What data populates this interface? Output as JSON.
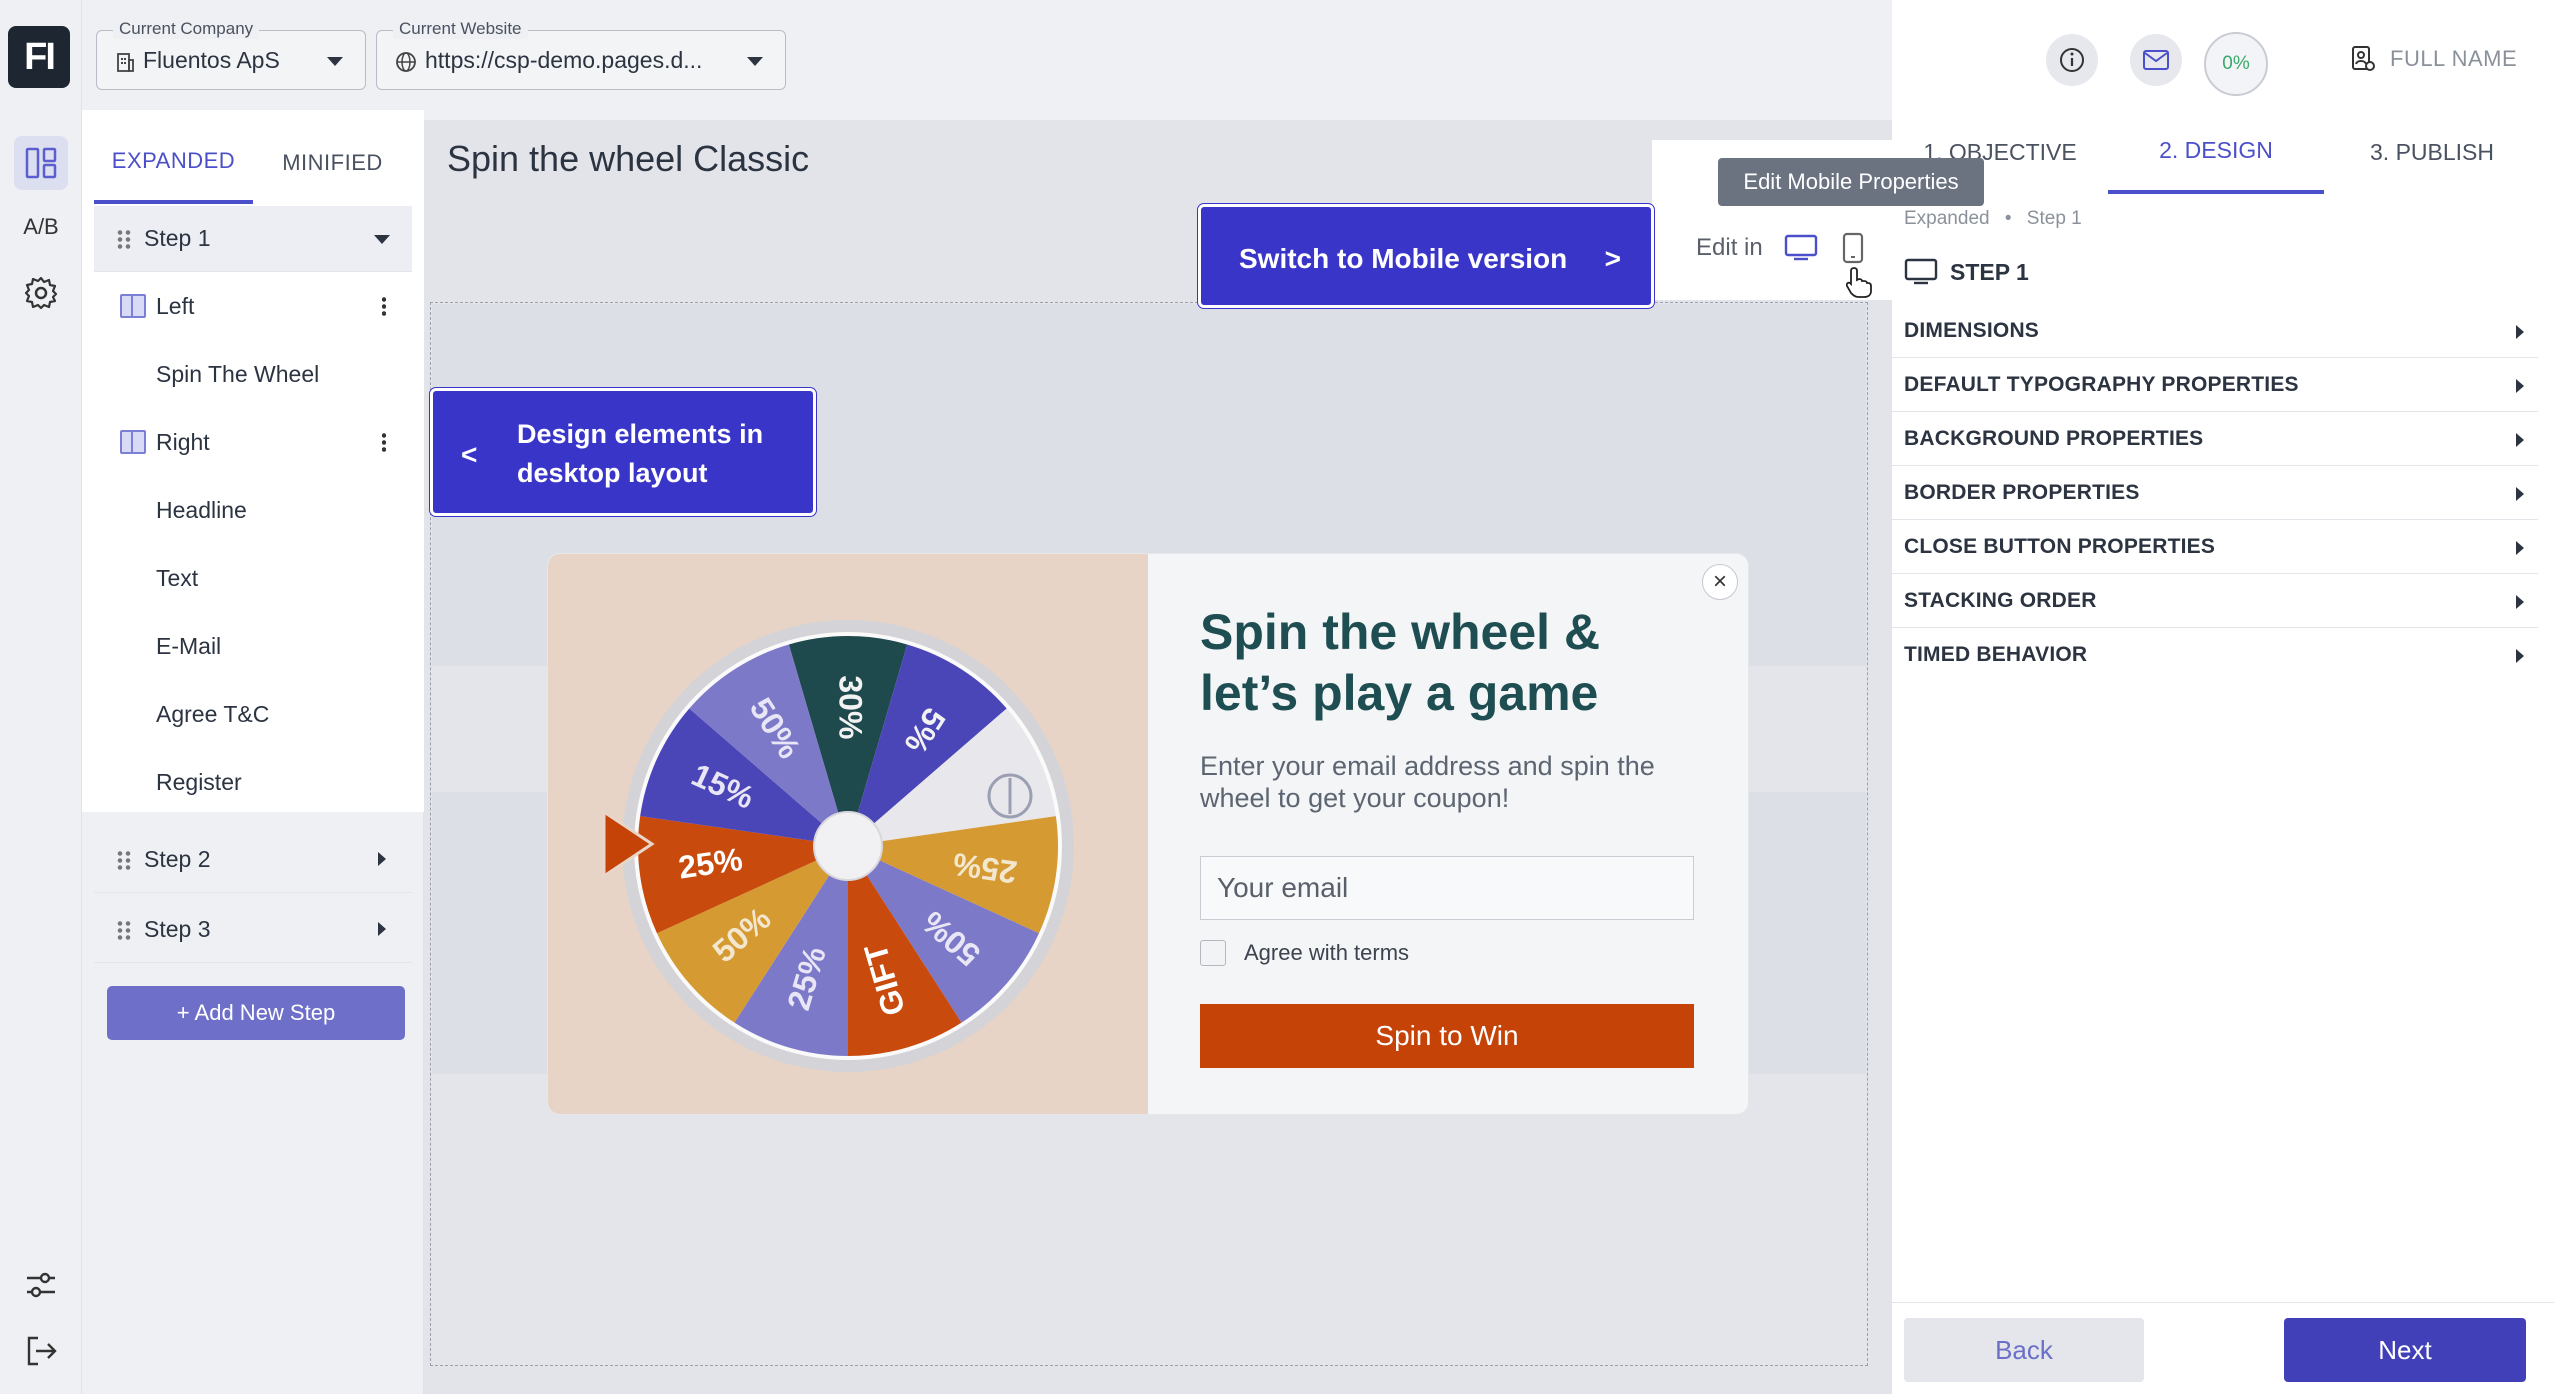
{
  "app": {
    "logo": "FI"
  },
  "rail": {
    "ab_label": "A/B"
  },
  "header": {
    "company": {
      "legend": "Current Company",
      "value": "Fluentos ApS"
    },
    "website": {
      "legend": "Current Website",
      "value": "https://csp-demo.pages.d..."
    },
    "progress": "0%",
    "user": "FULL NAME"
  },
  "left_panel": {
    "tabs": [
      "EXPANDED",
      "MINIFIED"
    ],
    "step1": "Step 1",
    "left": "Left",
    "left_children": [
      "Spin The Wheel"
    ],
    "right": "Right",
    "right_children": [
      "Headline",
      "Text",
      "E-Mail",
      "Agree T&C",
      "Register"
    ],
    "step2": "Step 2",
    "step3": "Step 3",
    "add_step": "+ Add New Step"
  },
  "main": {
    "title": "Spin the wheel Classic",
    "edit_in": "Edit in",
    "tooltip": "Edit Mobile Properties",
    "callout_mobile": "Switch to Mobile version",
    "callout_mobile_arrow": ">",
    "callout_desktop": "Design elements in desktop layout",
    "callout_desktop_arrow": "<"
  },
  "popup": {
    "headline": "Spin the wheel & let’s play a game",
    "subtext": "Enter your email address and spin the wheel to get your coupon!",
    "email_placeholder": "Your email",
    "agree": "Agree with terms",
    "button": "Spin to Win",
    "close": "×",
    "wheel_labels": [
      "30%",
      "5%",
      "25%",
      "50%",
      "GIFT",
      "25%",
      "50%",
      "25%",
      "15%",
      "50%"
    ]
  },
  "right_panel": {
    "tabs": [
      "1. OBJECTIVE",
      "2. DESIGN",
      "3. PUBLISH"
    ],
    "breadcrumb": [
      "Expanded",
      "Step 1"
    ],
    "breadcrumb_sep": "•",
    "step_title": "STEP 1",
    "properties": [
      "DIMENSIONS",
      "DEFAULT TYPOGRAPHY PROPERTIES",
      "BACKGROUND PROPERTIES",
      "BORDER PROPERTIES",
      "CLOSE BUTTON PROPERTIES",
      "STACKING ORDER",
      "TIMED BEHAVIOR"
    ],
    "back": "Back",
    "next": "Next"
  },
  "colors": {
    "accent": "#4b4fc9",
    "callout": "#3a35c9",
    "spin_button": "#c64308",
    "headline": "#1f4e52"
  }
}
